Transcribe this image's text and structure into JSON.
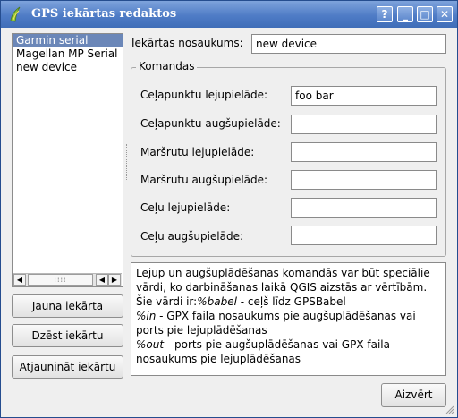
{
  "window": {
    "title": "GPS iekārtas redaktos",
    "buttons": {
      "help": "?",
      "minimize": "_",
      "maximize": "□",
      "close": "✕"
    },
    "title_gradient": "#4f7cc6"
  },
  "devices": {
    "items": [
      "Garmin serial",
      "Magellan MP Serial",
      "new device"
    ],
    "selected_index": 0,
    "scroll_left": "◀",
    "scroll_right": "▶",
    "scroll_thumb": "⁞⁞⁞⁞"
  },
  "actions": {
    "new_device": "Jauna iekārta",
    "delete_device": "Dzēst iekārtu",
    "update_device": "Atjaunināt iekārtu"
  },
  "device_name": {
    "label": "Iekārtas nosaukums:",
    "value": "new device"
  },
  "commands": {
    "group_title": "Komandas",
    "fields": [
      {
        "label": "Ceļapunktu lejupielāde:",
        "value": "foo bar"
      },
      {
        "label": "Ceļapunktu augšupielāde:",
        "value": ""
      },
      {
        "label": "Maršrutu lejupielāde:",
        "value": ""
      },
      {
        "label": "Maršrutu augšupielāde:",
        "value": ""
      },
      {
        "label": "Ceļu lejupielāde:",
        "value": ""
      },
      {
        "label": "Ceļu augšupielāde:",
        "value": ""
      }
    ]
  },
  "help": {
    "line1": "Lejup un augšuplādēšanas komandās var būt speciālie vārdi, ko darbināšanas laikā QGIS aizstās ar vērtībām.",
    "line2_prefix": "Šie vārdi ir:",
    "babel_token": "%babel",
    "babel_desc": " - ceļš līdz GPSBabel",
    "in_token": "%in",
    "in_desc": " - GPX faila nosaukums pie augšuplādēšanas vai ports pie lejuplādēšanas",
    "out_token": "%out",
    "out_desc": " - ports pie augšuplādēšanas vai GPX faila nosaukums pie lejuplādēšanas"
  },
  "close_button": "Aizvērt"
}
